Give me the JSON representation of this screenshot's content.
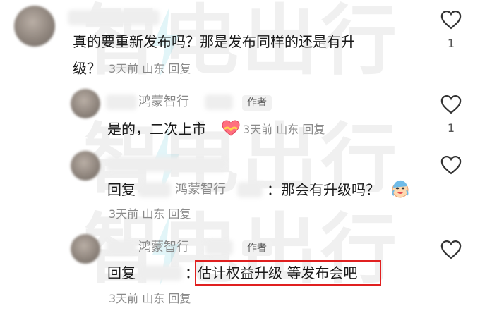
{
  "watermark": {
    "text": "智电出行"
  },
  "comments": [
    {
      "text_line1": "真的要重新发布吗？那是发布同样的还是有升",
      "text_line2_prefix": "级？",
      "meta": "3天前 山东 回复",
      "likes": "1"
    },
    {
      "author": "鸿蒙智行",
      "author_tag": "作者",
      "text": "是的，二次上市",
      "emoji": "heart-hands-icon",
      "meta": "3天前 山东 回复",
      "likes": "1"
    },
    {
      "reply_label": "回复",
      "reply_to": "鸿蒙智行",
      "text": "：那会有升级吗？",
      "emoji": "crying-laughing-icon",
      "meta": "3天前 山东 回复",
      "likes": ""
    },
    {
      "author": "鸿蒙智行",
      "author_tag": "作者",
      "reply_label": "回复",
      "text_prefix": "：",
      "highlighted_text": "估计权益升级 等发布会吧",
      "meta": "3天前 山东 回复",
      "likes": ""
    }
  ],
  "colors": {
    "highlight_border": "#e02020",
    "secondary_text": "#8a8a8a"
  }
}
